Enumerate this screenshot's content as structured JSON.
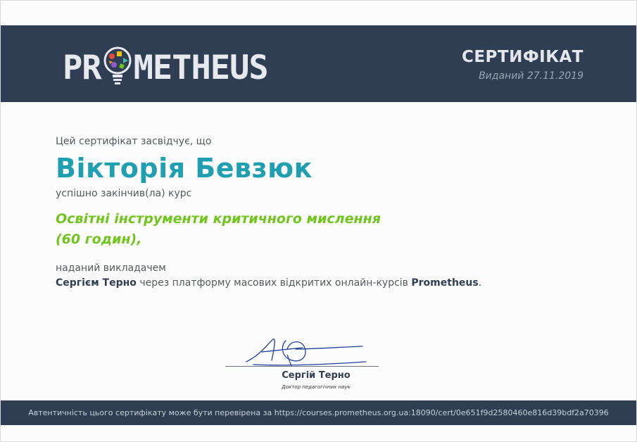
{
  "header": {
    "logo_left": "PR",
    "logo_right": "METHEUS",
    "title": "СЕРТИФІКАТ",
    "issued": "Виданий 27.11.2019"
  },
  "content": {
    "intro": "Цей сертифікат засвідчує, що",
    "recipient": "Вікторія Бевзюк",
    "completed": "успішно закінчив(ла) курс",
    "course_title": "Освітні інструменти критичного мислення",
    "course_hours": "(60 годин),",
    "given_by": "наданий викладачем",
    "teacher": "Сергієм Терно",
    "via": " через платформу масових відкритих онлайн-курсів ",
    "platform": "Prometheus",
    "period": "."
  },
  "signature": {
    "name": "Сергій Терно",
    "title": "Доктор педагогічних наук"
  },
  "footer": {
    "verify_text": "Автентичність цього сертифікату може бути перевірена за https://courses.prometheus.org.ua:18090/cert/0e651f9d2580460e816d39bdf2a70396"
  },
  "colors": {
    "header_bg": "#2f3e52",
    "name": "#1f9fb0",
    "course": "#6fc51c"
  }
}
